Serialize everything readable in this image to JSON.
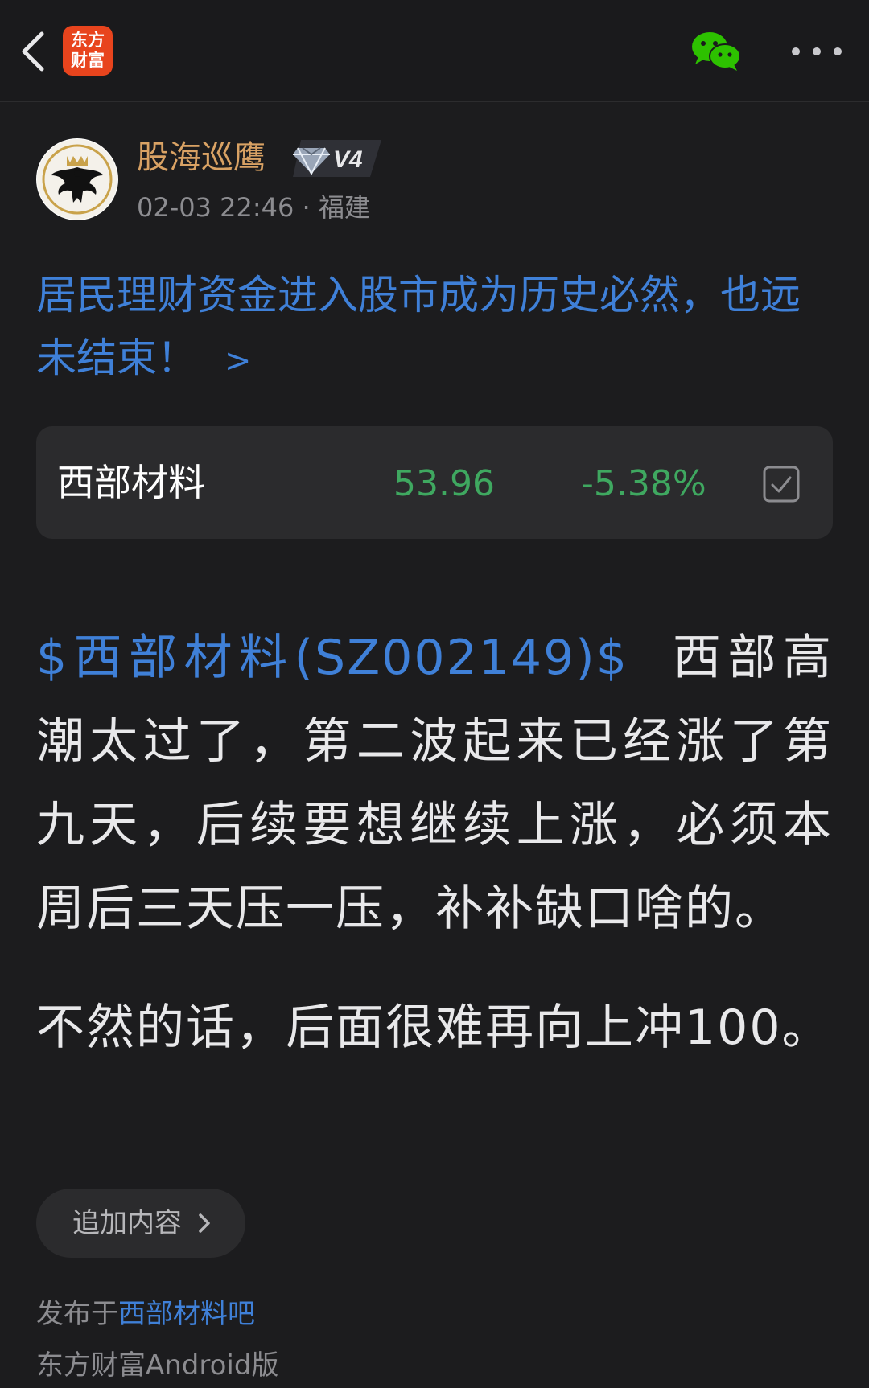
{
  "topbar": {
    "back_icon": "chevron-left-icon",
    "app_logo_line1": "东方",
    "app_logo_line2": "财富",
    "share_icon": "wechat-icon",
    "more_icon": "more-horizontal-icon"
  },
  "author": {
    "name": "股海巡鹰",
    "level": "V4",
    "avatar_icon": "eagle-crown-emblem",
    "badge_icon": "diamond-icon"
  },
  "post": {
    "timestamp": "02-03 22:46",
    "location": "· 福建"
  },
  "headline": {
    "text": "居民理财资金进入股市成为历史必然，也远未结束！",
    "arrow": ">"
  },
  "stock_card": {
    "name": "西部材料",
    "price": "53.96",
    "change": "-5.38%",
    "check_icon": "checkbox-checked-icon"
  },
  "body": {
    "stock_tag": "$西部材料(SZ002149)$",
    "paragraph1": "西部高潮太过了，第二波起来已经涨了第九天，后续要想继续上涨，必须本周后三天压一压，补补缺口啥的。",
    "paragraph2": "不然的话，后面很难再向上冲100。"
  },
  "append_button": {
    "label": "追加内容",
    "chevron_icon": "chevron-right-icon"
  },
  "footer": {
    "published_prefix": "发布于",
    "forum_link": "西部材料吧",
    "client": "东方财富Android版"
  },
  "colors": {
    "background": "#1c1c1e",
    "card": "#2b2b2d",
    "link_blue": "#3f80d8",
    "author_gold": "#d9a264",
    "down_green": "#3fa860",
    "logo_orange": "#e8441d",
    "wechat_green": "#2dc100"
  }
}
